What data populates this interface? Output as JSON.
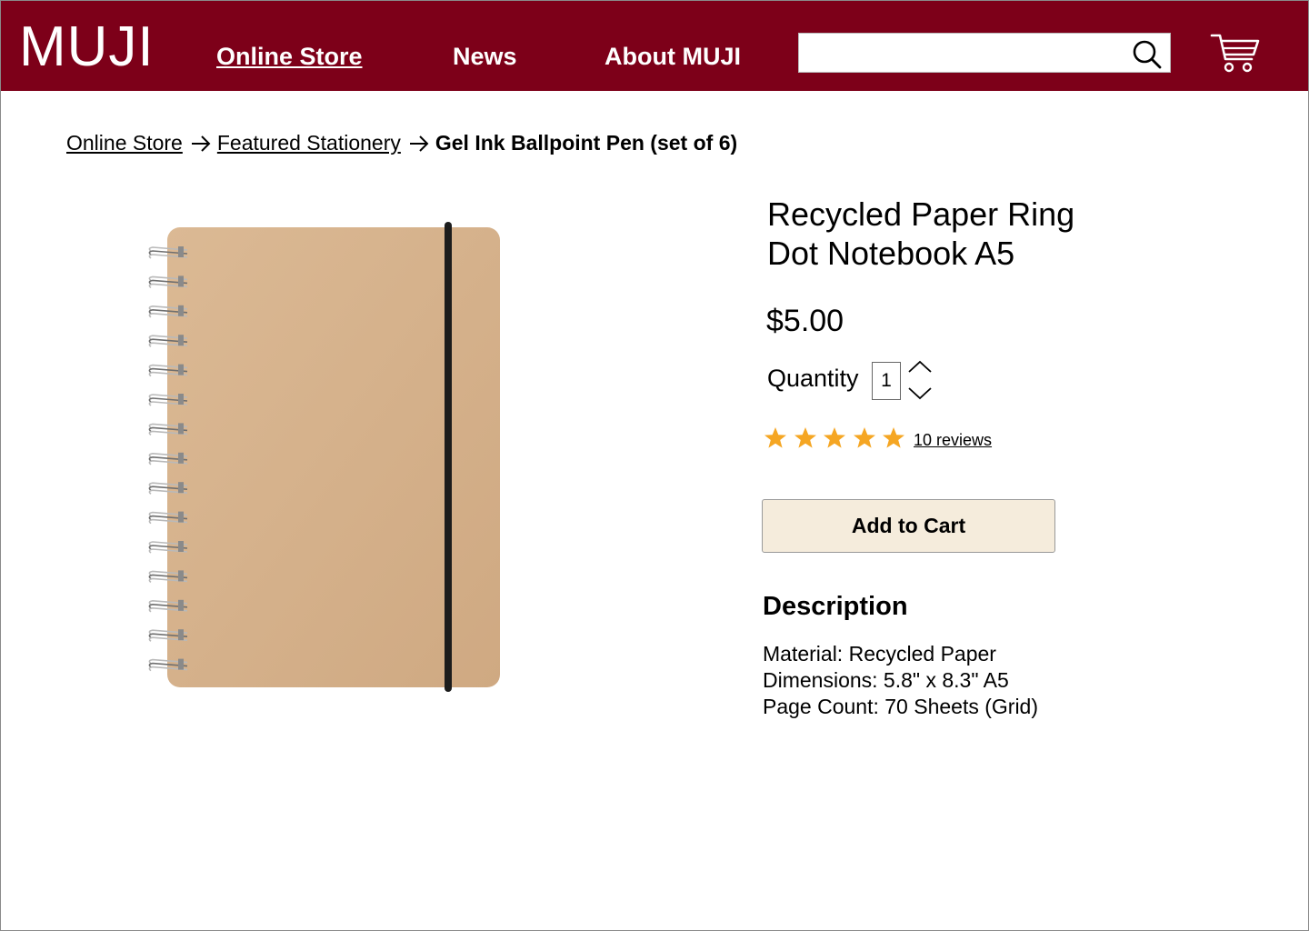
{
  "header": {
    "logo": "MUJI",
    "nav": [
      {
        "label": "Online Store",
        "active": true
      },
      {
        "label": "News",
        "active": false
      },
      {
        "label": "About MUJI",
        "active": false
      }
    ],
    "search": {
      "value": "",
      "placeholder": ""
    },
    "icons": {
      "search": "search-icon",
      "cart": "cart-icon"
    }
  },
  "breadcrumb": {
    "items": [
      "Online Store",
      "Featured Stationery"
    ],
    "current": "Gel Ink Ballpoint Pen (set of 6)"
  },
  "product": {
    "title_line1": "Recycled Paper Ring",
    "title_line2": "Dot Notebook A5",
    "price": "$5.00",
    "quantity_label": "Quantity",
    "quantity_value": "1",
    "rating": 5,
    "rating_max": 5,
    "reviews_label": "10 reviews",
    "add_to_cart_label": "Add to Cart",
    "image_alt": "Recycled paper ring notebook with kraft cover and black elastic band"
  },
  "description": {
    "heading": "Description",
    "lines": [
      "Material: Recycled Paper",
      "Dimensions: 5.8\" x 8.3\" A5",
      "Page Count: 70 Sheets (Grid)"
    ]
  },
  "colors": {
    "header_bg": "#7d0019",
    "cart_button_bg": "#f5ecdc",
    "star": "#f5a623",
    "notebook_cover": "#d4b08c"
  }
}
